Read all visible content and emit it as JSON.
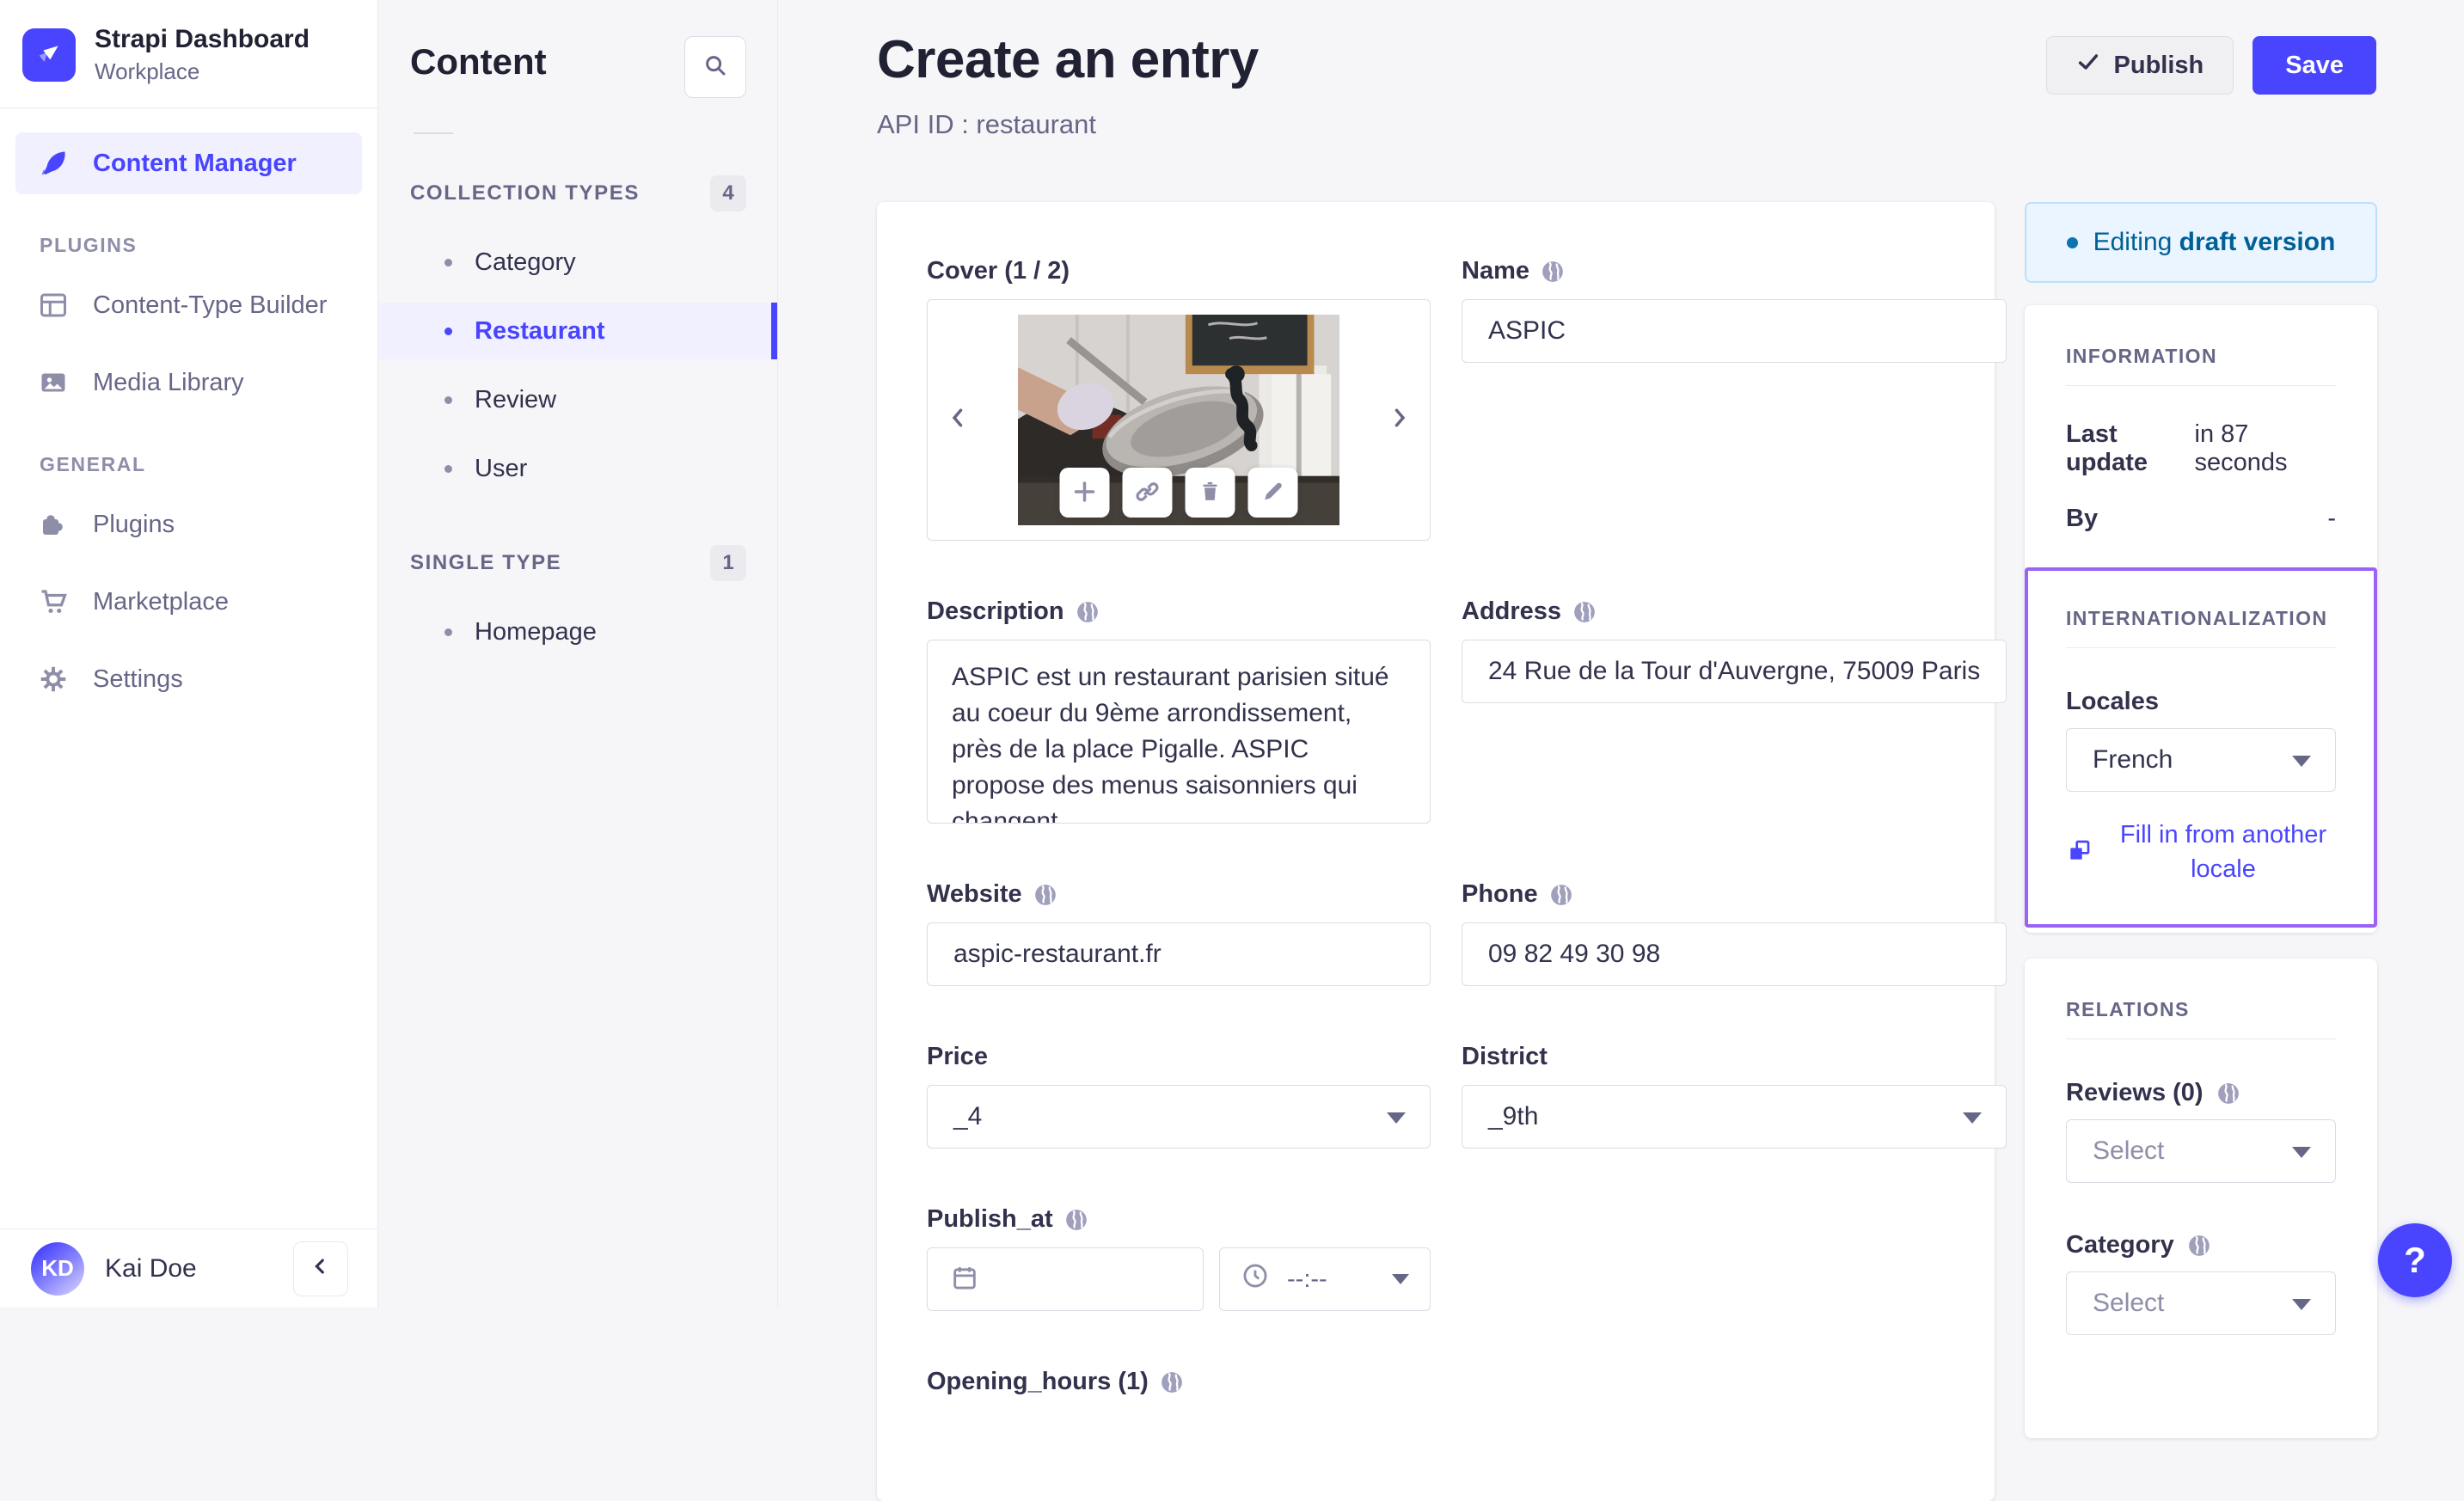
{
  "app": {
    "name": "Strapi Dashboard",
    "workspace": "Workplace"
  },
  "sidebar": {
    "content_manager": "Content Manager",
    "sections": [
      {
        "title": "PLUGINS",
        "items": [
          {
            "label": "Content-Type Builder"
          },
          {
            "label": "Media Library"
          }
        ]
      },
      {
        "title": "GENERAL",
        "items": [
          {
            "label": "Plugins"
          },
          {
            "label": "Marketplace"
          },
          {
            "label": "Settings"
          }
        ]
      }
    ],
    "user": {
      "initials": "KD",
      "name": "Kai Doe"
    }
  },
  "content_nav": {
    "title": "Content",
    "collection_types": {
      "title": "COLLECTION TYPES",
      "count": "4",
      "items": [
        "Category",
        "Restaurant",
        "Review",
        "User"
      ],
      "active": "Restaurant"
    },
    "single_type": {
      "title": "SINGLE TYPE",
      "count": "1",
      "items": [
        "Homepage"
      ]
    }
  },
  "header": {
    "title": "Create an entry",
    "subtitle": "API ID : restaurant",
    "publish_label": "Publish",
    "save_label": "Save"
  },
  "form": {
    "cover": {
      "label": "Cover (1 / 2)"
    },
    "name": {
      "label": "Name",
      "value": "ASPIC"
    },
    "description": {
      "label": "Description",
      "value": "ASPIC est un restaurant parisien situé au coeur du 9ème arrondissement, près de la place Pigalle. ASPIC propose des menus saisonniers qui changent"
    },
    "address": {
      "label": "Address",
      "value": "24 Rue de la Tour d'Auvergne, 75009 Paris"
    },
    "website": {
      "label": "Website",
      "value": "aspic-restaurant.fr"
    },
    "phone": {
      "label": "Phone",
      "value": "09 82 49 30 98"
    },
    "price": {
      "label": "Price",
      "value": "_4"
    },
    "district": {
      "label": "District",
      "value": "_9th"
    },
    "publish_at": {
      "label": "Publish_at",
      "date_value": "",
      "time_placeholder": "--:--"
    },
    "opening_hours": {
      "label": "Opening_hours (1)"
    }
  },
  "status_panel": {
    "draft_banner": {
      "prefix": "Editing",
      "emphasis": "draft version"
    },
    "information": {
      "title": "INFORMATION",
      "last_update_label": "Last update",
      "last_update_value": "in 87 seconds",
      "by_label": "By",
      "by_value": "-"
    },
    "internationalization": {
      "title": "INTERNATIONALIZATION",
      "locales_label": "Locales",
      "locale_value": "French",
      "fill_link": "Fill in from another locale"
    },
    "relations": {
      "title": "RELATIONS",
      "reviews_label": "Reviews (0)",
      "category_label": "Category",
      "select_placeholder": "Select"
    }
  },
  "help_label": "?",
  "icons": [
    "strapi-logo-icon",
    "content-manager-icon",
    "content-type-builder-icon",
    "media-library-icon",
    "plugins-icon",
    "marketplace-icon",
    "settings-icon",
    "search-icon",
    "check-icon",
    "globe-icon",
    "chevron-left-icon",
    "chevron-right-icon",
    "plus-icon",
    "link-icon",
    "trash-icon",
    "pencil-icon",
    "calendar-icon",
    "clock-icon",
    "dropdown-caret-icon",
    "copy-locale-icon",
    "collapse-icon",
    "help-icon"
  ],
  "colors": {
    "brand": "#4945ff",
    "brand_light_bg": "#f0f0ff",
    "page_bg": "#f6f6f9",
    "border": "#dcdce4",
    "divider": "#eaeaef",
    "text": "#32324d",
    "text_muted": "#666687",
    "draft_bg": "#eaf5ff",
    "draft_border": "#b8e1ff",
    "draft_text": "#006096",
    "i18n_outline": "#9b63f5"
  }
}
